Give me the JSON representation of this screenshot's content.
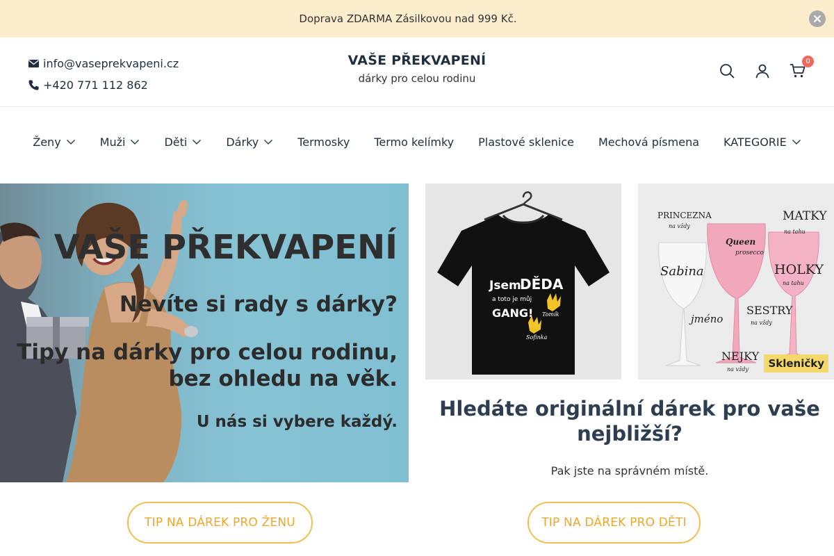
{
  "topbar": {
    "message": "Doprava ZDARMA Zásilkovou nad 999 Kč."
  },
  "contact": {
    "email": "info@vaseprekvapeni.cz",
    "phone": "+420 771 112 862"
  },
  "brand": {
    "title": "VAŠE PŘEKVAPENÍ",
    "subtitle": "dárky pro celou rodinu"
  },
  "header": {
    "cart_count": "0"
  },
  "nav": {
    "items": [
      {
        "label": "Ženy"
      },
      {
        "label": "Muži"
      },
      {
        "label": "Děti"
      },
      {
        "label": "Dárky"
      },
      {
        "label": "Termosky"
      },
      {
        "label": "Termo kelímky"
      },
      {
        "label": "Plastové sklenice"
      },
      {
        "label": "Mechová písmena"
      },
      {
        "label": "KATEGORIE"
      }
    ]
  },
  "hero": {
    "title": "VAŠE PŘEKVAPENÍ",
    "line1": "Nevíte si rady s dárky?",
    "line2": "Tipy na dárky pro celou rodinu, bez ohledu na věk.",
    "line3": "U nás si vybere každý."
  },
  "products": {
    "tshirt": {
      "line1": "Jsem",
      "line2": "DĚDA",
      "line3": "a toto je můj",
      "line4": "GANG!",
      "name1": "Tomík",
      "name2": "Sofinka"
    },
    "glasses": {
      "label": "Skleničky",
      "texts": [
        "PRINCEZNA",
        "na vždy",
        "MATKY",
        "na tahu",
        "Queen",
        "prosecco",
        "Sabina",
        "HOLKY",
        "na tahu",
        "jméno",
        "SESTRY",
        "na vždy",
        "NEJKY",
        "na vždy"
      ]
    }
  },
  "promo": {
    "title": "Hledáte originální dárek pro vaše nejbližší?",
    "subtitle": "Pak jste na správném místě."
  },
  "buttons": {
    "women": "TIP NA DÁREK PRO ŽENU",
    "kids": "TIP NA DÁREK PRO DĚTI"
  },
  "colors": {
    "topbar_bg": "#fbeccb",
    "accent": "#f0a629",
    "badge": "#f06a5b",
    "text": "#1f2f3f"
  }
}
